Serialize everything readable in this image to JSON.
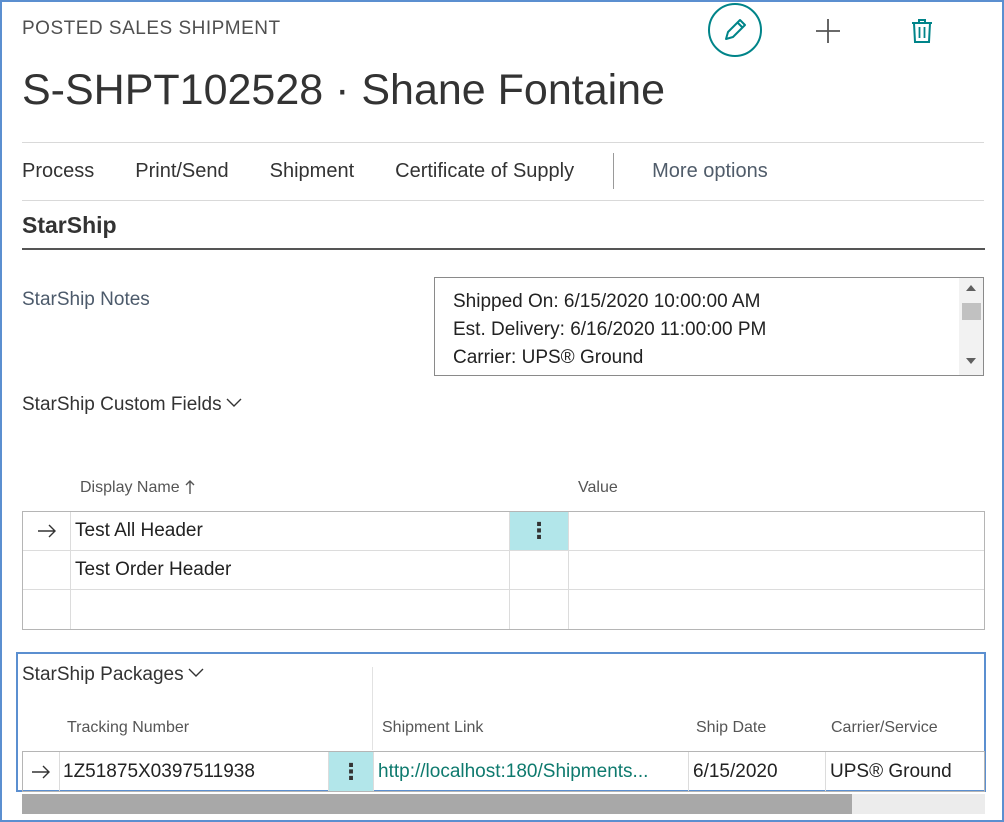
{
  "header": {
    "caption": "POSTED SALES SHIPMENT",
    "title": "S-SHPT102528 · Shane Fontaine"
  },
  "icons": {
    "edit": "pencil-icon",
    "new": "plus-icon",
    "delete": "trash-icon",
    "row_indicator": "arrow-right-icon",
    "row_menu": "ellipsis-vertical-icon",
    "expand": "chevron-down-icon",
    "sort": "arrow-up-icon"
  },
  "actions": {
    "items": [
      "Process",
      "Print/Send",
      "Shipment",
      "Certificate of Supply"
    ],
    "more": "More options"
  },
  "section": {
    "title": "StarShip"
  },
  "notes": {
    "label": "StarShip Notes",
    "lines": [
      "Shipped On: 6/15/2020 10:00:00 AM",
      "Est. Delivery: 6/16/2020 11:00:00 PM",
      "Carrier: UPS® Ground"
    ]
  },
  "custom_fields": {
    "label": "StarShip Custom Fields",
    "columns": {
      "display_name": "Display Name",
      "value": "Value"
    },
    "rows": [
      {
        "display_name": "Test All Header",
        "value": ""
      },
      {
        "display_name": "Test Order Header",
        "value": ""
      },
      {
        "display_name": "",
        "value": ""
      }
    ]
  },
  "packages": {
    "label": "StarShip Packages",
    "columns": {
      "tracking": "Tracking Number",
      "link": "Shipment Link",
      "date": "Ship Date",
      "carrier": "Carrier/Service"
    },
    "rows": [
      {
        "tracking": "1Z51875X0397511938",
        "link": "http://localhost:180/Shipments...",
        "date": "6/15/2020",
        "carrier": "UPS® Ground"
      }
    ]
  },
  "colors": {
    "accent": "#008489",
    "link": "#0e7a6e",
    "selected_menu": "#b2e6ea",
    "focus_frame": "#5b8fd0"
  }
}
